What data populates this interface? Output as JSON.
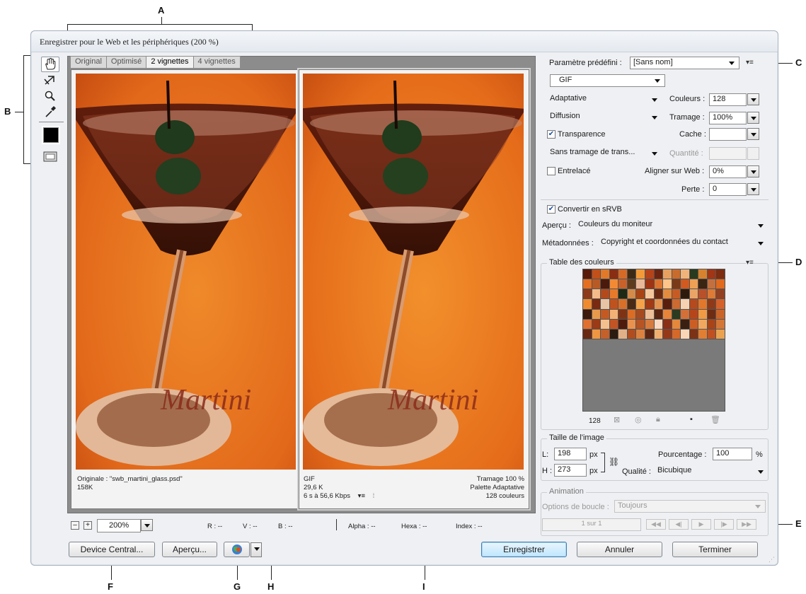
{
  "callouts": [
    "A",
    "B",
    "C",
    "D",
    "E",
    "F",
    "G",
    "H",
    "I"
  ],
  "dialog": {
    "title": "Enregistrer pour le Web et les périphériques (200 %)"
  },
  "tools": [
    {
      "name": "hand-icon",
      "glyph": "✋"
    },
    {
      "name": "slice-select-icon",
      "glyph": "✄"
    },
    {
      "name": "zoom-icon",
      "glyph": "🔍"
    },
    {
      "name": "eyedropper-icon",
      "glyph": "✎"
    },
    {
      "name": "color-swatch-icon",
      "glyph": ""
    },
    {
      "name": "toggle-slices-icon",
      "glyph": "▣"
    }
  ],
  "tabs": [
    {
      "label": "Original",
      "active": false
    },
    {
      "label": "Optimisé",
      "active": false
    },
    {
      "label": "2 vignettes",
      "active": true
    },
    {
      "label": "4 vignettes",
      "active": false
    }
  ],
  "panes": {
    "left": {
      "image_text": "Martini",
      "info_line1": "Originale : \"swb_martini_glass.psd\"",
      "info_line2": "158K"
    },
    "right": {
      "image_text": "Martini",
      "format": "GIF",
      "size": "29,6 K",
      "speed": "6 s à 56,6 Kbps",
      "dither": "Tramage 100 %",
      "palette": "Palette Adaptative",
      "colors": "128 couleurs"
    }
  },
  "status": {
    "zoom": "200%",
    "r": "R : --",
    "v": "V : --",
    "b": "B : --",
    "alpha": "Alpha : --",
    "hexa": "Hexa : --",
    "index": "Index : --"
  },
  "buttons": {
    "device_central": "Device Central...",
    "apercu": "Aperçu...",
    "enregistrer": "Enregistrer",
    "annuler": "Annuler",
    "terminer": "Terminer"
  },
  "settings": {
    "preset_label": "Paramètre prédéfini :",
    "preset_value": "[Sans nom]",
    "format": "GIF",
    "reduction": "Adaptative",
    "colors_label": "Couleurs :",
    "colors_value": "128",
    "dither_algo": "Diffusion",
    "dither_label": "Tramage :",
    "dither_value": "100%",
    "transparency_label": "Transparence",
    "transparency_checked": true,
    "matte_label": "Cache :",
    "matte_value": "",
    "trans_dither": "Sans tramage de trans...",
    "amount_label": "Quantité :",
    "interlaced_label": "Entrelacé",
    "interlaced_checked": false,
    "web_snap_label": "Aligner sur Web :",
    "web_snap_value": "0%",
    "lossy_label": "Perte :",
    "lossy_value": "0",
    "srgb_label": "Convertir en sRVB",
    "srgb_checked": true,
    "preview_label": "Aperçu :",
    "preview_value": "Couleurs du moniteur",
    "metadata_label": "Métadonnées :",
    "metadata_value": "Copyright et coordonnées du contact"
  },
  "color_table": {
    "title": "Table des couleurs",
    "count": "128",
    "swatches": [
      "#5a1a0a",
      "#c2501a",
      "#e07a2a",
      "#8a2d12",
      "#d56a26",
      "#3e2a14",
      "#f29a3a",
      "#b5431a",
      "#6b2410",
      "#e8a060",
      "#c86c2e",
      "#f0b47a",
      "#2a3a1e",
      "#d7822e",
      "#a03616",
      "#7c2c10",
      "#e46f22",
      "#b85a26",
      "#4a1a0c",
      "#f28a34",
      "#c8622a",
      "#5e3b1d",
      "#e8b89a",
      "#9e3414",
      "#da7430",
      "#ffc48a",
      "#7a3a18",
      "#d05a20",
      "#efa054",
      "#3a2412",
      "#c27040",
      "#e06a1e",
      "#8c3a1a",
      "#f3bb8a",
      "#b24a1c",
      "#e67a2a",
      "#1e2a14",
      "#d48a4a",
      "#a84414",
      "#f5c89c",
      "#6a2a12",
      "#e28c40",
      "#c65c24",
      "#2e1a0c",
      "#eaa566",
      "#b8502a",
      "#dc7a36",
      "#924022",
      "#f08a30",
      "#7a2a10",
      "#e8c4a4",
      "#c0521e",
      "#d8702a",
      "#4a2a14",
      "#f4a24a",
      "#a23a14",
      "#e49250",
      "#5c1e0c",
      "#cc6a30",
      "#f6d2b2",
      "#b44a1e",
      "#e2782c",
      "#8e3a18",
      "#d4602a",
      "#3c1a0c",
      "#e89a4c",
      "#c45a22",
      "#f2b276",
      "#7e3414",
      "#da6c24",
      "#a64a20",
      "#ecbf98",
      "#5a2410",
      "#e6843a",
      "#2c3a20",
      "#d27038",
      "#b6461a",
      "#f09a44",
      "#6e2c12",
      "#c8642a",
      "#e07030",
      "#9a3a16",
      "#f4c08e",
      "#c25424",
      "#4e1c0c",
      "#e99250",
      "#b65424",
      "#d67c3e",
      "#fadac0",
      "#8a3016",
      "#e4883c",
      "#3a2010",
      "#cc5e24",
      "#f0a860",
      "#a84418",
      "#d47636",
      "#6a2812",
      "#ee9642",
      "#c4602a",
      "#2a1a10",
      "#e2b088",
      "#b04c1e",
      "#dc8240",
      "#5e2612",
      "#f2b070",
      "#963818",
      "#d6682a",
      "#f8d6b6",
      "#7c3214",
      "#e07e34",
      "#c05020",
      "#eaa250"
    ]
  },
  "image_size": {
    "title": "Taille de l'image",
    "w_label": "L:",
    "w_value": "198",
    "h_label": "H :",
    "h_value": "273",
    "unit": "px",
    "percent_label": "Pourcentage :",
    "percent_value": "100",
    "percent_unit": "%",
    "quality_label": "Qualité :",
    "quality_value": "Bicubique"
  },
  "animation": {
    "title": "Animation",
    "loop_label": "Options de boucle :",
    "loop_value": "Toujours",
    "frame": "1 sur 1"
  }
}
